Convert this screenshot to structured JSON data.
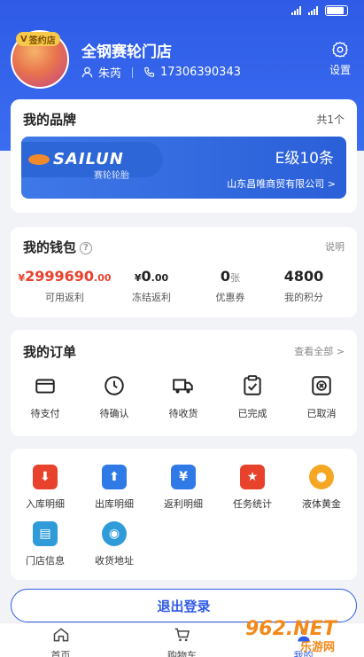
{
  "profile": {
    "badge": "签约店",
    "shop_name": "全钢赛轮门店",
    "contact_name": "朱芮",
    "phone": "17306390343",
    "settings_label": "设置"
  },
  "brand": {
    "title": "我的品牌",
    "count": "共1个",
    "logo": "SAILUN",
    "logo_cn": "赛轮轮胎",
    "level": "E级10条",
    "company": "山东昌唯商贸有限公司 >"
  },
  "wallet": {
    "title": "我的钱包",
    "help": "?",
    "explain": "说明",
    "items": [
      {
        "prefix": "¥",
        "value": "2999690",
        "suffix": ".00",
        "label": "可用返利",
        "color": "#e8412c"
      },
      {
        "prefix": "¥",
        "value": "0",
        "suffix": ".00",
        "label": "冻结返利",
        "color": "#222222"
      },
      {
        "prefix": "",
        "value": "0",
        "suffix": "张",
        "label": "优惠券",
        "color": "#222222"
      },
      {
        "prefix": "",
        "value": "4800",
        "suffix": "",
        "label": "我的积分",
        "color": "#222222"
      }
    ]
  },
  "orders": {
    "title": "我的订单",
    "view_all": "查看全部 >",
    "items": [
      {
        "label": "待支付",
        "icon": "card-icon"
      },
      {
        "label": "待确认",
        "icon": "clock-icon"
      },
      {
        "label": "待收货",
        "icon": "truck-icon"
      },
      {
        "label": "已完成",
        "icon": "clipboard-check-icon"
      },
      {
        "label": "已取消",
        "icon": "cancel-box-icon"
      }
    ]
  },
  "tools": [
    {
      "label": "入库明细",
      "icon": "inbound-icon",
      "color": "#e8412c"
    },
    {
      "label": "出库明细",
      "icon": "outbound-icon",
      "color": "#2f7ae6"
    },
    {
      "label": "返利明细",
      "icon": "rebate-icon",
      "color": "#2f7ae6"
    },
    {
      "label": "任务统计",
      "icon": "star-flag-icon",
      "color": "#e8412c"
    },
    {
      "label": "液体黄金",
      "icon": "coin-icon",
      "color": "#f5a623"
    },
    {
      "label": "门店信息",
      "icon": "store-icon",
      "color": "#2f9bd8"
    },
    {
      "label": "收货地址",
      "icon": "location-pin-icon",
      "color": "#2f9bd8"
    }
  ],
  "logout_label": "退出登录",
  "tabbar": [
    {
      "label": "首页",
      "icon": "home-icon",
      "active": false
    },
    {
      "label": "购物车",
      "icon": "cart-icon",
      "active": false
    },
    {
      "label": "我的",
      "icon": "user-icon",
      "active": true
    }
  ],
  "watermark": {
    "number": "962.NET",
    "text": "乐游网"
  },
  "colors": {
    "primary": "#2f5be6",
    "accent_red": "#e8412c",
    "background": "#f2f3f7"
  }
}
